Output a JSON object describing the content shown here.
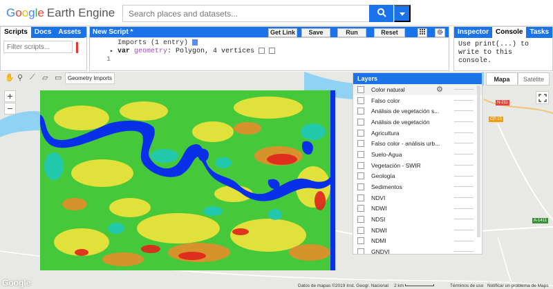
{
  "app": {
    "logo_google": [
      "G",
      "o",
      "o",
      "g",
      "l",
      "e"
    ],
    "logo_product": "Earth Engine"
  },
  "search": {
    "placeholder": "Search places and datasets..."
  },
  "scripts_panel": {
    "tabs": [
      "Scripts",
      "Docs",
      "Assets"
    ],
    "filter_placeholder": "Filter scripts..."
  },
  "editor": {
    "title": "New Script *",
    "buttons": {
      "get_link": "Get Link",
      "save": "Save",
      "run": "Run",
      "reset": "Reset"
    },
    "imports_line": "Imports (1 entry)",
    "var_kw": "var",
    "var_name": "geometry",
    "var_rest": ": Polygon, 4 vertices",
    "line_number": "1"
  },
  "right_panel": {
    "tabs": [
      "Inspector",
      "Console",
      "Tasks"
    ],
    "console_text": "Use print(...) to\nwrite to this\nconsole."
  },
  "map": {
    "geometry_imports": "Geometry Imports",
    "map_types": [
      "Mapa",
      "Satélite"
    ],
    "zoom_in": "+",
    "zoom_out": "−",
    "roads": [
      "N-211",
      "CP-15",
      "A-1411"
    ],
    "footer": {
      "attribution": "Datos de mapas ©2019 Inst. Geogr. Nacional",
      "scale": "2 km",
      "terms": "Términos de uso",
      "report": "Notificar un problema de Maps",
      "google": "Google"
    }
  },
  "layers": {
    "title": "Layers",
    "items": [
      "Color natural",
      "Falso color",
      "Análisis de vegetación s...",
      "Análisis de vegetación",
      "Agricultura",
      "Falso color - análisis urb...",
      "Suelo-Agua",
      "Vegetación - SWIR",
      "Geología",
      "Sedimentos",
      "NDVI",
      "NDWI",
      "NDSI",
      "NDWI",
      "NDMI",
      "GNDVI"
    ]
  },
  "colors": {
    "accent": "#1a73e8",
    "water": "#0a2fe8",
    "veg": "#3ccc36"
  }
}
